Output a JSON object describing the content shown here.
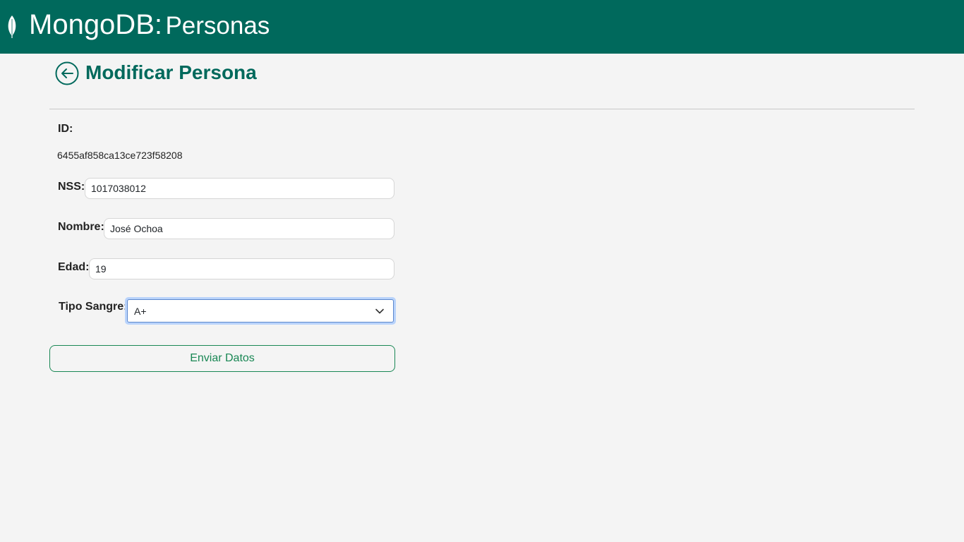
{
  "navbar": {
    "brand_main": "MongoDB:",
    "brand_sub": "Personas",
    "logo_icon": "leaf-icon",
    "background": "#00695c"
  },
  "page": {
    "back_icon": "arrow-left-circle-icon",
    "title": "Modificar Persona",
    "accent": "#00695c"
  },
  "form": {
    "id_label": "ID:",
    "id_value": "6455af858ca13ce723f58208",
    "nss_label": "NSS:",
    "nss_value": "1017038012",
    "nombre_label": "Nombre:",
    "nombre_value": "José Ochoa",
    "edad_label": "Edad:",
    "edad_value": "19",
    "tipo_sangre_label": "Tipo Sangre:",
    "tipo_sangre_value": "A+",
    "submit_label": "Enviar Datos",
    "submit_color": "#198754"
  }
}
